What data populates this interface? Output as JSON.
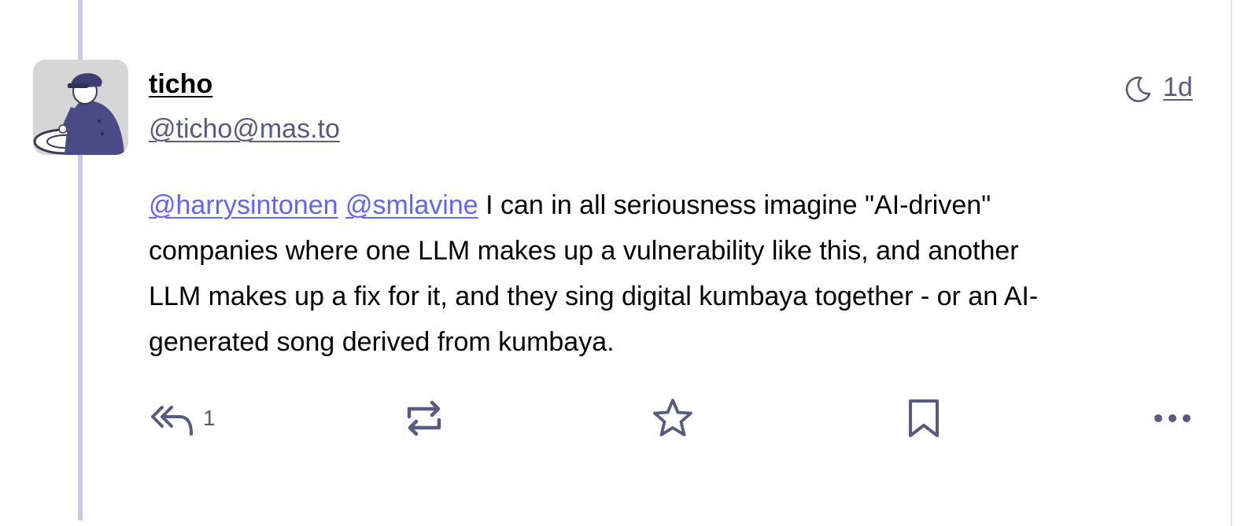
{
  "post": {
    "author": {
      "display_name": "ticho",
      "acct": "@ticho@mas.to"
    },
    "visibility_icon": "moon-icon",
    "timestamp": "1d",
    "content": {
      "mention_1": "@harrysintonen",
      "mention_2": "@smlavine",
      "line_1_text": " I can in all seriousness imagine \"AI-driven\"",
      "line_2": "companies where one LLM makes up a vulnerability like this, and another",
      "line_3": "LLM makes up a fix for it, and they sing digital kumbaya together - or an AI-",
      "line_4": "generated song derived from kumbaya."
    },
    "actions": {
      "reply_icon": "reply-all-icon",
      "reply_count": "1",
      "boost_icon": "boost-icon",
      "favourite_icon": "star-icon",
      "bookmark_icon": "bookmark-icon",
      "more_icon": "more-horizontal-icon"
    }
  },
  "colors": {
    "accent": "#6364ff",
    "secondary_text": "#595a80",
    "thread_line": "#c9c9e6"
  }
}
